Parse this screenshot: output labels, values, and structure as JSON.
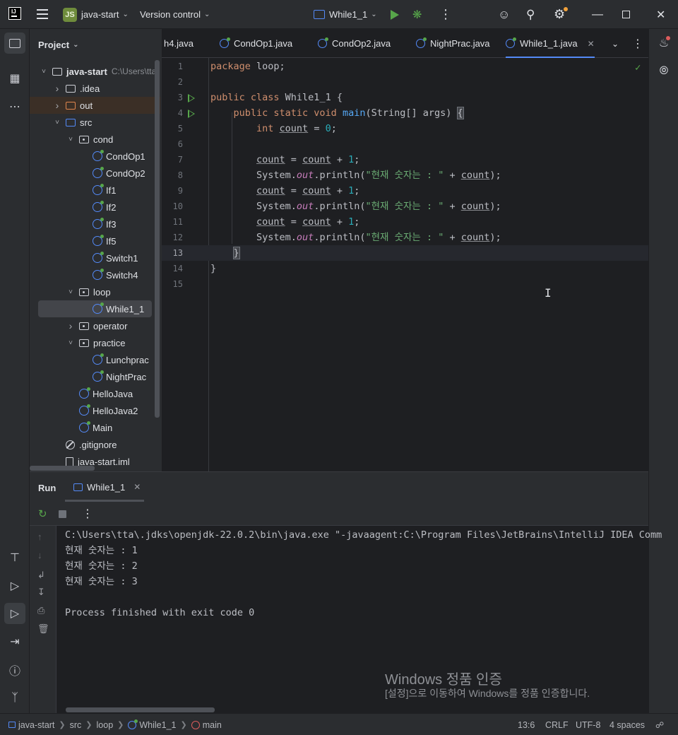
{
  "titlebar": {
    "project_badge": "JS",
    "project_name": "java-start",
    "vcs_menu": "Version control",
    "run_config": "While1_1"
  },
  "project_panel": {
    "title": "Project",
    "tree": [
      {
        "label": "java-start",
        "path": "C:\\Users\\tta",
        "kind": "module",
        "depth": 0,
        "arrow": "down"
      },
      {
        "label": ".idea",
        "kind": "folder",
        "depth": 1,
        "arrow": "right"
      },
      {
        "label": "out",
        "kind": "folder-excluded",
        "depth": 1,
        "arrow": "right"
      },
      {
        "label": "src",
        "kind": "folder-src",
        "depth": 1,
        "arrow": "down"
      },
      {
        "label": "cond",
        "kind": "package",
        "depth": 2,
        "arrow": "down"
      },
      {
        "label": "CondOp1",
        "kind": "class",
        "depth": 3
      },
      {
        "label": "CondOp2",
        "kind": "class",
        "depth": 3
      },
      {
        "label": "If1",
        "kind": "class",
        "depth": 3
      },
      {
        "label": "If2",
        "kind": "class",
        "depth": 3
      },
      {
        "label": "If3",
        "kind": "class",
        "depth": 3
      },
      {
        "label": "If5",
        "kind": "class",
        "depth": 3
      },
      {
        "label": "Switch1",
        "kind": "class",
        "depth": 3
      },
      {
        "label": "Switch4",
        "kind": "class",
        "depth": 3
      },
      {
        "label": "loop",
        "kind": "package",
        "depth": 2,
        "arrow": "down"
      },
      {
        "label": "While1_1",
        "kind": "class",
        "depth": 3,
        "selected": true
      },
      {
        "label": "operator",
        "kind": "package",
        "depth": 2,
        "arrow": "right"
      },
      {
        "label": "practice",
        "kind": "package",
        "depth": 2,
        "arrow": "down"
      },
      {
        "label": "Lunchprac",
        "kind": "class",
        "depth": 3
      },
      {
        "label": "NightPrac",
        "kind": "class",
        "depth": 3
      },
      {
        "label": "HelloJava",
        "kind": "class",
        "depth": 2
      },
      {
        "label": "HelloJava2",
        "kind": "class",
        "depth": 2
      },
      {
        "label": "Main",
        "kind": "class",
        "depth": 2
      },
      {
        "label": ".gitignore",
        "kind": "gitignore",
        "depth": 1
      },
      {
        "label": "java-start.iml",
        "kind": "file",
        "depth": 1
      }
    ]
  },
  "editor_tabs": [
    {
      "label": "h4.java",
      "icon": false
    },
    {
      "label": "CondOp1.java",
      "icon": true
    },
    {
      "label": "CondOp2.java",
      "icon": true
    },
    {
      "label": "NightPrac.java",
      "icon": true
    },
    {
      "label": "While1_1.java",
      "icon": true,
      "active": true
    }
  ],
  "editor": {
    "current_line": 13,
    "run_gutter_lines": [
      3,
      4
    ],
    "lines": [
      [
        [
          "kw",
          "package"
        ],
        [
          "plain",
          " loop;"
        ]
      ],
      [],
      [
        [
          "kw",
          "public class "
        ],
        [
          "plain",
          "While1_1 {"
        ]
      ],
      [
        [
          "plain",
          "    "
        ],
        [
          "kw",
          "public static void "
        ],
        [
          "fn",
          "main"
        ],
        [
          "plain",
          "(String[] args) "
        ],
        [
          "hl",
          "{"
        ]
      ],
      [
        [
          "plain",
          "        "
        ],
        [
          "kw",
          "int "
        ],
        [
          "var",
          "count"
        ],
        [
          "plain",
          " = "
        ],
        [
          "num",
          "0"
        ],
        [
          "plain",
          ";"
        ]
      ],
      [],
      [
        [
          "plain",
          "        "
        ],
        [
          "var",
          "count"
        ],
        [
          "plain",
          " = "
        ],
        [
          "var",
          "count"
        ],
        [
          "plain",
          " + "
        ],
        [
          "num",
          "1"
        ],
        [
          "plain",
          ";"
        ]
      ],
      [
        [
          "plain",
          "        System."
        ],
        [
          "static",
          "out"
        ],
        [
          "plain",
          ".println("
        ],
        [
          "str",
          "\"현재 숫자는 : \""
        ],
        [
          "plain",
          " + "
        ],
        [
          "var",
          "count"
        ],
        [
          "plain",
          ");"
        ]
      ],
      [
        [
          "plain",
          "        "
        ],
        [
          "var",
          "count"
        ],
        [
          "plain",
          " = "
        ],
        [
          "var",
          "count"
        ],
        [
          "plain",
          " + "
        ],
        [
          "num",
          "1"
        ],
        [
          "plain",
          ";"
        ]
      ],
      [
        [
          "plain",
          "        System."
        ],
        [
          "static",
          "out"
        ],
        [
          "plain",
          ".println("
        ],
        [
          "str",
          "\"현재 숫자는 : \""
        ],
        [
          "plain",
          " + "
        ],
        [
          "var",
          "count"
        ],
        [
          "plain",
          ");"
        ]
      ],
      [
        [
          "plain",
          "        "
        ],
        [
          "var",
          "count"
        ],
        [
          "plain",
          " = "
        ],
        [
          "var",
          "count"
        ],
        [
          "plain",
          " + "
        ],
        [
          "num",
          "1"
        ],
        [
          "plain",
          ";"
        ]
      ],
      [
        [
          "plain",
          "        System."
        ],
        [
          "static",
          "out"
        ],
        [
          "plain",
          ".println("
        ],
        [
          "str",
          "\"현재 숫자는 : \""
        ],
        [
          "plain",
          " + "
        ],
        [
          "var",
          "count"
        ],
        [
          "plain",
          ");"
        ]
      ],
      [
        [
          "plain",
          "    "
        ],
        [
          "hl",
          "}"
        ]
      ],
      [
        [
          "plain",
          "}"
        ]
      ],
      []
    ]
  },
  "run_panel": {
    "title": "Run",
    "tab_label": "While1_1",
    "console": [
      "C:\\Users\\tta\\.jdks\\openjdk-22.0.2\\bin\\java.exe \"-javaagent:C:\\Program Files\\JetBrains\\IntelliJ IDEA Comm",
      "현재 숫자는 : 1",
      "현재 숫자는 : 2",
      "현재 숫자는 : 3",
      "",
      "Process finished with exit code 0"
    ]
  },
  "watermark": {
    "line1": "Windows 정품 인증",
    "line2": "[설정]으로 이동하여 Windows를 정품 인증합니다."
  },
  "statusbar": {
    "breadcrumb": [
      "java-start",
      "src",
      "loop",
      "While1_1",
      "main"
    ],
    "position": "13:6",
    "line_sep": "CRLF",
    "encoding": "UTF-8",
    "indent": "4 spaces"
  }
}
